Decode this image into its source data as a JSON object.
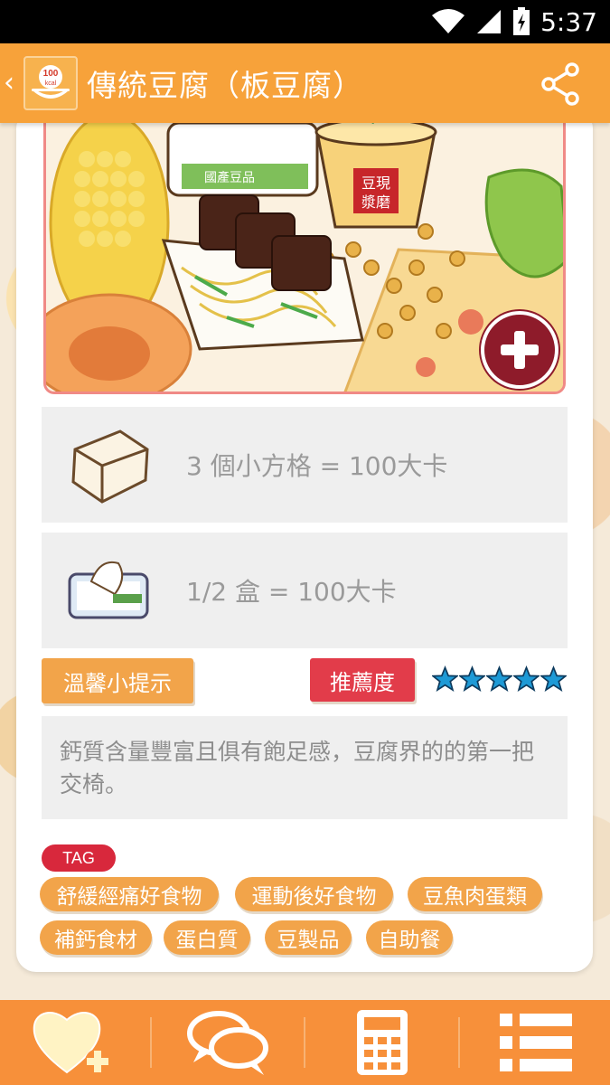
{
  "status_bar": {
    "time": "5:37"
  },
  "app_bar": {
    "back": "‹",
    "logo_text": "100",
    "logo_sub": "kcal",
    "title": "傳統豆腐（板豆腐）"
  },
  "hero": {
    "cup_label_1": "豆現",
    "cup_label_2": "漿磨",
    "box_label": "國產豆品"
  },
  "portions": [
    {
      "icon": "tofu-cube-icon",
      "text": "3 個小方格 = 100大卡"
    },
    {
      "icon": "tofu-box-icon",
      "text": "1/2 盒 = 100大卡"
    }
  ],
  "tips": {
    "label": "溫馨小提示",
    "text": "鈣質含量豐富且俱有飽足感，豆腐界的的第一把交椅。"
  },
  "recommend": {
    "label": "推薦度",
    "stars": 5,
    "star_color": "#1e9ad6"
  },
  "tags": {
    "label": "TAG",
    "items": [
      "舒緩經痛好食物",
      "運動後好食物",
      "豆魚肉蛋類",
      "補鈣食材",
      "蛋白質",
      "豆製品",
      "自助餐"
    ]
  },
  "bottom_nav": [
    {
      "icon": "heart-add-icon"
    },
    {
      "icon": "chat-bubbles-icon"
    },
    {
      "icon": "calculator-icon"
    },
    {
      "icon": "list-icon"
    }
  ],
  "colors": {
    "app_bar": "#f7a23a",
    "tag_bg": "#f2a44a",
    "recommend_bg": "#e23c4a",
    "add_button": "#8e1b2a"
  }
}
